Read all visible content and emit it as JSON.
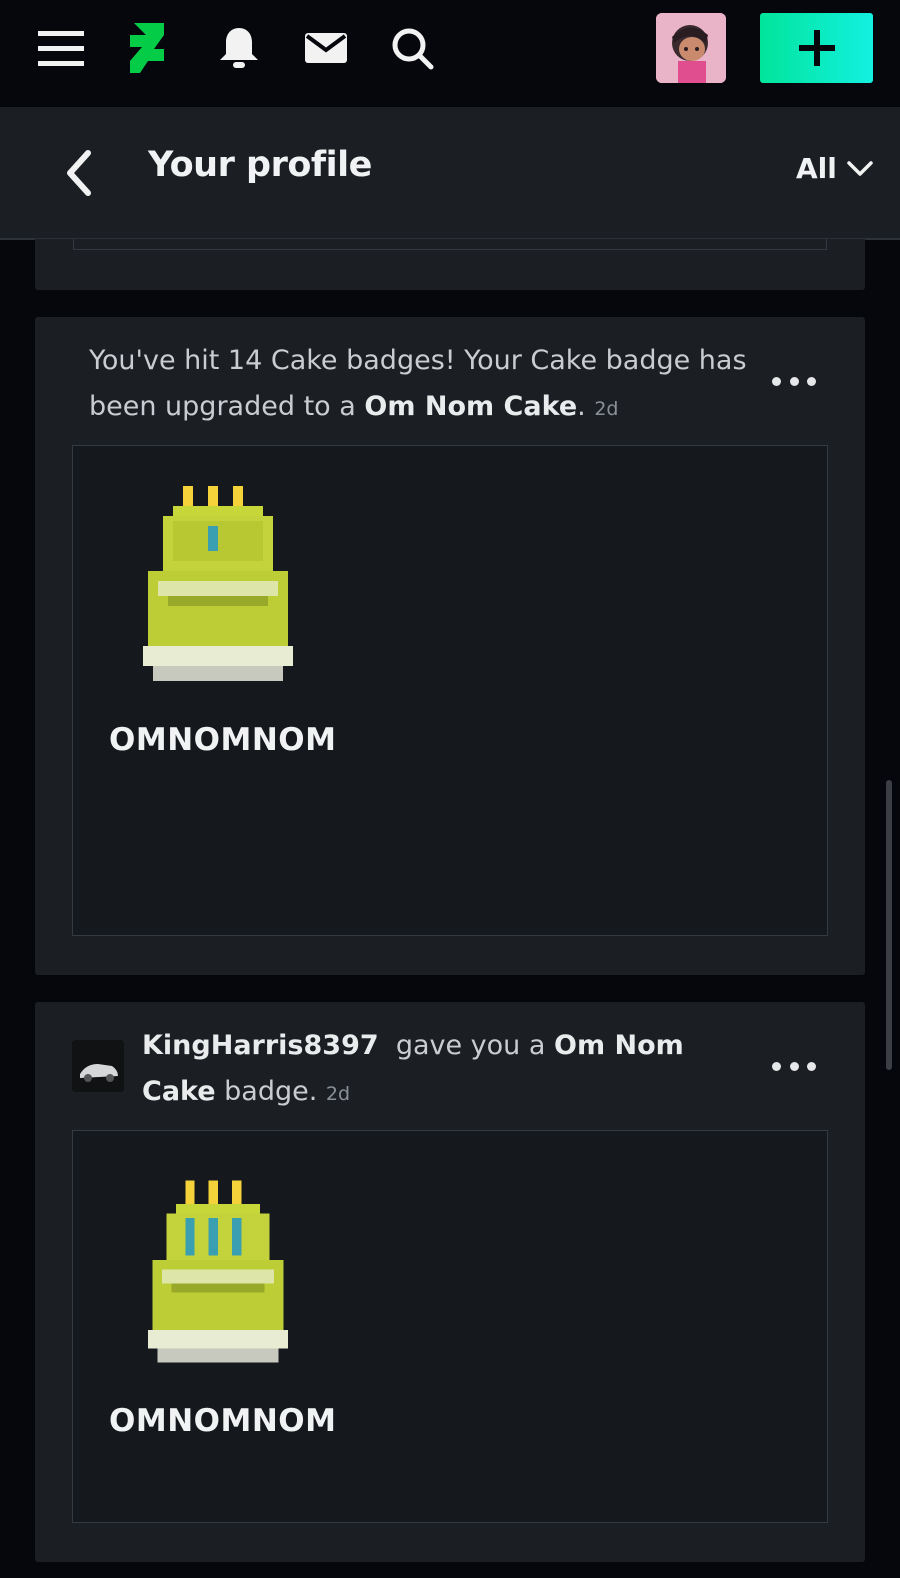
{
  "topbar": {
    "icons": [
      "menu-icon",
      "deviantart-logo",
      "bell-icon",
      "mail-icon",
      "search-icon",
      "plus-icon"
    ],
    "accent": "#00e59b"
  },
  "header": {
    "title": "Your profile",
    "filter": "All"
  },
  "notifications": [
    {
      "text_prefix": "You've hit 14 Cake badges! Your Cake badge has been upgraded to a ",
      "highlight": "Om Nom Cake",
      "suffix": ".",
      "time": "2d",
      "badge_name": "OMNOMNOM"
    },
    {
      "username": "KingHarris8397",
      "text_mid": "gave you a",
      "highlight": "Om Nom Cake",
      "suffix": "badge.",
      "time": "2d",
      "badge_name": "OMNOMNOM"
    }
  ]
}
